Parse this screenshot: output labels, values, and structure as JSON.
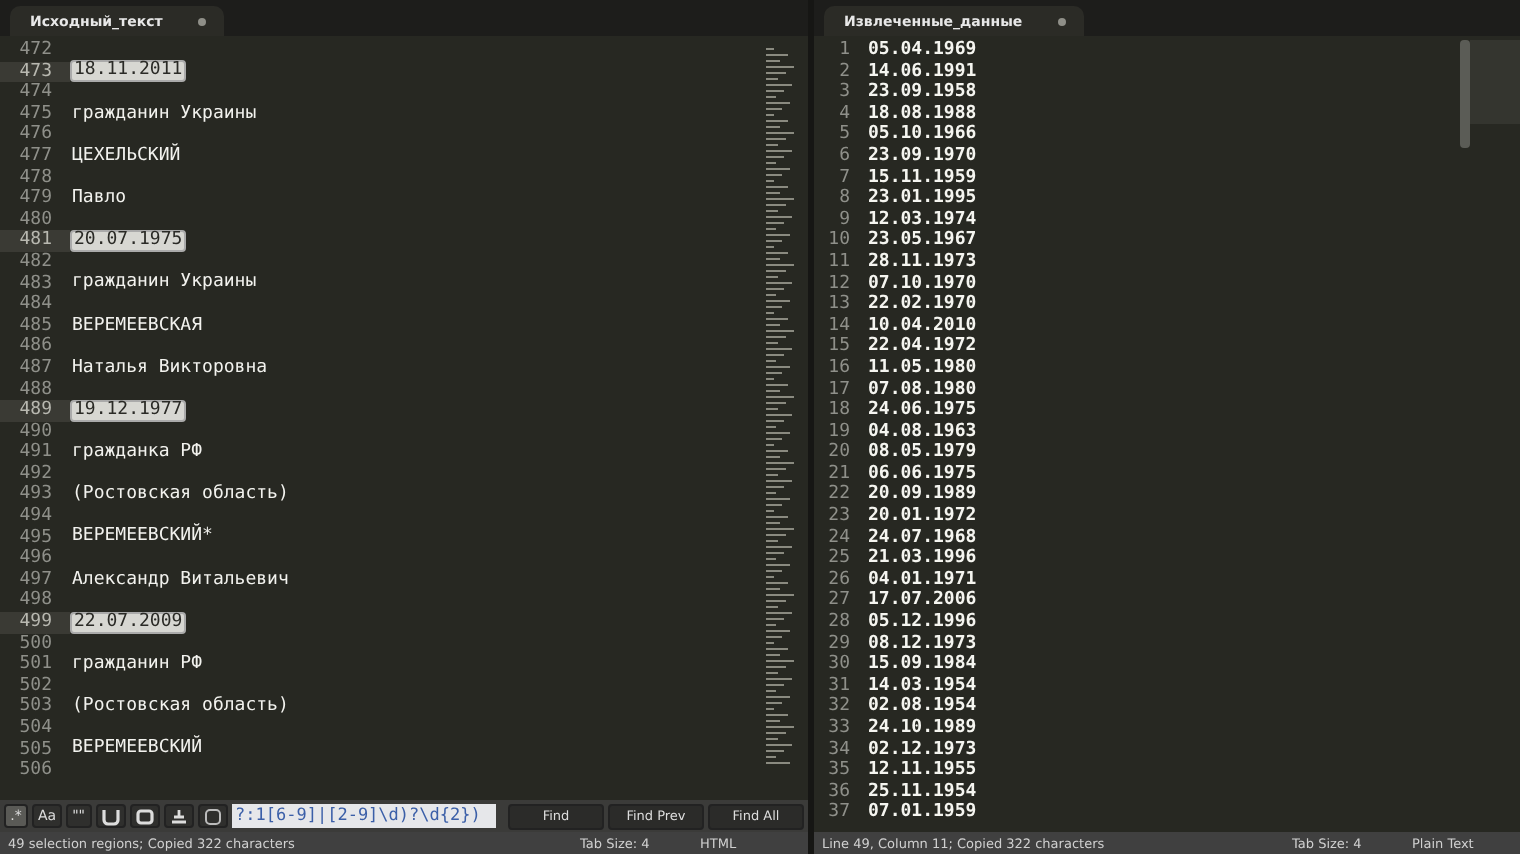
{
  "left_pane": {
    "tab": {
      "title": "Исходный_текст",
      "modified": true
    },
    "lines": [
      {
        "number": "472"
      },
      {
        "number": "473",
        "text": "18.11.2011",
        "selected": true
      },
      {
        "number": "474"
      },
      {
        "number": "475",
        "text": "гражданин Украины",
        "selected": false
      },
      {
        "number": "476"
      },
      {
        "number": "477",
        "text": "ЦЕХЕЛЬСКИЙ",
        "selected": false
      },
      {
        "number": "478"
      },
      {
        "number": "479",
        "text": "Павло",
        "selected": false
      },
      {
        "number": "480"
      },
      {
        "number": "481",
        "text": "20.07.1975",
        "selected": true
      },
      {
        "number": "482"
      },
      {
        "number": "483",
        "text": "гражданин Украины",
        "selected": false
      },
      {
        "number": "484"
      },
      {
        "number": "485",
        "text": "ВЕРЕМЕЕВСКАЯ",
        "selected": false
      },
      {
        "number": "486"
      },
      {
        "number": "487",
        "text": "Наталья Викторовна",
        "selected": false
      },
      {
        "number": "488"
      },
      {
        "number": "489",
        "text": "19.12.1977",
        "selected": true
      },
      {
        "number": "490"
      },
      {
        "number": "491",
        "text": "гражданка РФ",
        "selected": false
      },
      {
        "number": "492"
      },
      {
        "number": "493",
        "text": "(Ростовская область)",
        "selected": false
      },
      {
        "number": "494"
      },
      {
        "number": "495",
        "text": "ВЕРЕМЕЕВСКИЙ*",
        "selected": false
      },
      {
        "number": "496"
      },
      {
        "number": "497",
        "text": "Александр Витальевич",
        "selected": false
      },
      {
        "number": "498"
      },
      {
        "number": "499",
        "text": "22.07.2009",
        "selected": true
      },
      {
        "number": "500"
      },
      {
        "number": "501",
        "text": "гражданин РФ",
        "selected": false
      },
      {
        "number": "502"
      },
      {
        "number": "503",
        "text": "(Ростовская область)",
        "selected": false
      },
      {
        "number": "504"
      },
      {
        "number": "505",
        "text": "ВЕРЕМЕЕВСКИЙ",
        "selected": false
      },
      {
        "number": "506"
      }
    ],
    "find_bar": {
      "toggles": [
        {
          "kind": "text",
          "label": ".*",
          "on": true
        },
        {
          "kind": "text",
          "label": "Aa",
          "on": false
        },
        {
          "kind": "text",
          "label": "\"\"",
          "on": false
        },
        {
          "kind": "wrap",
          "on": false
        },
        {
          "kind": "selection",
          "on": false
        },
        {
          "kind": "highlight",
          "on": false
        },
        {
          "kind": "context",
          "on": false
        }
      ],
      "value": "?:1[6-9]|[2-9]\\d)?\\d{2})",
      "buttons": [
        "Find",
        "Find Prev",
        "Find All"
      ]
    },
    "status_bar": {
      "message": "49 selection regions; Copied 322 characters",
      "tab_size": "Tab Size: 4",
      "syntax": "HTML"
    }
  },
  "right_pane": {
    "tab": {
      "title": "Извлеченные_данные",
      "modified": true
    },
    "lines": [
      {
        "number": "1",
        "text": "05.04.1969"
      },
      {
        "number": "2",
        "text": "14.06.1991"
      },
      {
        "number": "3",
        "text": "23.09.1958"
      },
      {
        "number": "4",
        "text": "18.08.1988"
      },
      {
        "number": "5",
        "text": "05.10.1966"
      },
      {
        "number": "6",
        "text": "23.09.1970"
      },
      {
        "number": "7",
        "text": "15.11.1959"
      },
      {
        "number": "8",
        "text": "23.01.1995"
      },
      {
        "number": "9",
        "text": "12.03.1974"
      },
      {
        "number": "10",
        "text": "23.05.1967"
      },
      {
        "number": "11",
        "text": "28.11.1973"
      },
      {
        "number": "12",
        "text": "07.10.1970"
      },
      {
        "number": "13",
        "text": "22.02.1970"
      },
      {
        "number": "14",
        "text": "10.04.2010"
      },
      {
        "number": "15",
        "text": "22.04.1972"
      },
      {
        "number": "16",
        "text": "11.05.1980"
      },
      {
        "number": "17",
        "text": "07.08.1980"
      },
      {
        "number": "18",
        "text": "24.06.1975"
      },
      {
        "number": "19",
        "text": "04.08.1963"
      },
      {
        "number": "20",
        "text": "08.05.1979"
      },
      {
        "number": "21",
        "text": "06.06.1975"
      },
      {
        "number": "22",
        "text": "20.09.1989"
      },
      {
        "number": "23",
        "text": "20.01.1972"
      },
      {
        "number": "24",
        "text": "24.07.1968"
      },
      {
        "number": "25",
        "text": "21.03.1996"
      },
      {
        "number": "26",
        "text": "04.01.1971"
      },
      {
        "number": "27",
        "text": "17.07.2006"
      },
      {
        "number": "28",
        "text": "05.12.1996"
      },
      {
        "number": "29",
        "text": "08.12.1973"
      },
      {
        "number": "30",
        "text": "15.09.1984"
      },
      {
        "number": "31",
        "text": "14.03.1954"
      },
      {
        "number": "32",
        "text": "02.08.1954"
      },
      {
        "number": "33",
        "text": "24.10.1989"
      },
      {
        "number": "34",
        "text": "02.12.1973"
      },
      {
        "number": "35",
        "text": "12.11.1955"
      },
      {
        "number": "36",
        "text": "25.11.1954"
      },
      {
        "number": "37",
        "text": "07.01.1959"
      }
    ],
    "status_bar": {
      "message": "Line 49, Column 11; Copied 322 characters",
      "tab_size": "Tab Size: 4",
      "syntax": "Plain Text"
    }
  }
}
